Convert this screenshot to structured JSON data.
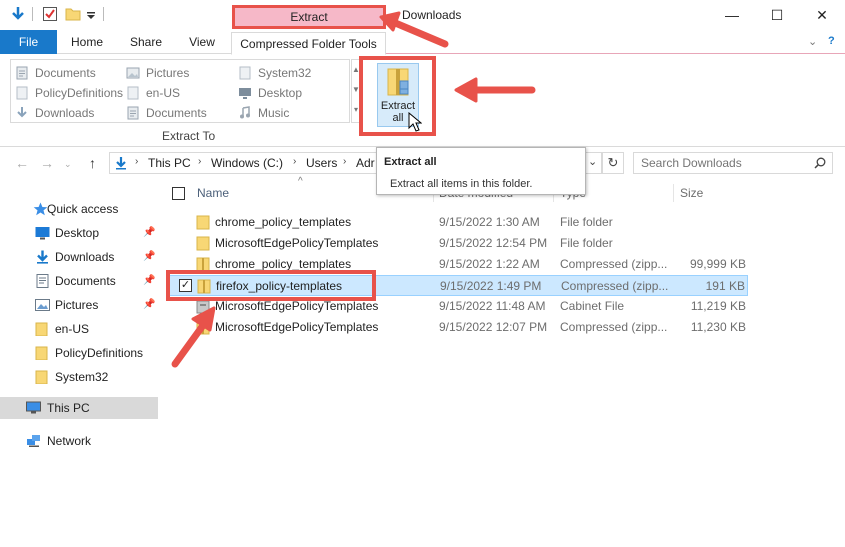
{
  "window": {
    "title": "Downloads",
    "context_tab_header": "Extract",
    "controls": {
      "minimize": "—",
      "maximize": "☐",
      "close": "✕"
    }
  },
  "ribbon": {
    "tabs": {
      "file": "File",
      "home": "Home",
      "share": "Share",
      "view": "View",
      "compressed": "Compressed Folder Tools"
    },
    "destinations": [
      {
        "label": "Documents",
        "icon": "documents-icon"
      },
      {
        "label": "Pictures",
        "icon": "pictures-icon"
      },
      {
        "label": "System32",
        "icon": "folder-icon"
      },
      {
        "label": "PolicyDefinitions",
        "icon": "folder-icon"
      },
      {
        "label": "en-US",
        "icon": "folder-icon"
      },
      {
        "label": "Desktop",
        "icon": "desktop-icon"
      },
      {
        "label": "Downloads",
        "icon": "downloads-icon"
      },
      {
        "label": "Documents",
        "icon": "documents-icon"
      },
      {
        "label": "Music",
        "icon": "music-icon"
      }
    ],
    "group_label": "Extract To",
    "extract_all": {
      "line1": "Extract",
      "line2": "all"
    }
  },
  "tooltip": {
    "title": "Extract all",
    "text": "Extract all items in this folder."
  },
  "address": {
    "segments": [
      "This PC",
      "Windows (C:)",
      "Users",
      "Adr"
    ],
    "search_placeholder": "Search Downloads"
  },
  "sidebar": {
    "items": [
      {
        "label": "Quick access",
        "icon": "star-icon",
        "pinned": false
      },
      {
        "label": "Desktop",
        "icon": "desktop-icon",
        "pinned": true
      },
      {
        "label": "Downloads",
        "icon": "downloads-icon",
        "pinned": true
      },
      {
        "label": "Documents",
        "icon": "documents-icon",
        "pinned": true
      },
      {
        "label": "Pictures",
        "icon": "pictures-icon",
        "pinned": true
      },
      {
        "label": "en-US",
        "icon": "folder-icon",
        "pinned": false
      },
      {
        "label": "PolicyDefinitions",
        "icon": "folder-icon",
        "pinned": false
      },
      {
        "label": "System32",
        "icon": "folder-icon",
        "pinned": false
      },
      {
        "label": "This PC",
        "icon": "computer-icon",
        "pinned": false
      },
      {
        "label": "Network",
        "icon": "network-icon",
        "pinned": false
      }
    ]
  },
  "file_list": {
    "columns": {
      "name": "Name",
      "date": "Date modified",
      "type": "Type",
      "size": "Size"
    },
    "rows": [
      {
        "name": "chrome_policy_templates",
        "date": "9/15/2022 1:30 AM",
        "type": "File folder",
        "size": "",
        "icon": "folder-icon"
      },
      {
        "name": "MicrosoftEdgePolicyTemplates",
        "date": "9/15/2022 12:54 PM",
        "type": "File folder",
        "size": "",
        "icon": "folder-icon"
      },
      {
        "name": "chrome_policy_templates",
        "date": "9/15/2022 1:22 AM",
        "type": "Compressed (zipp...",
        "size": "99,999 KB",
        "icon": "zip-folder-icon"
      },
      {
        "name": "firefox_policy-templates",
        "date": "9/15/2022 1:49 PM",
        "type": "Compressed (zipp...",
        "size": "191 KB",
        "icon": "zip-folder-icon",
        "selected": true
      },
      {
        "name": "MicrosoftEdgePolicyTemplates",
        "date": "9/15/2022 11:48 AM",
        "type": "Cabinet File",
        "size": "11,219 KB",
        "icon": "cabinet-file-icon"
      },
      {
        "name": "MicrosoftEdgePolicyTemplates",
        "date": "9/15/2022 12:07 PM",
        "type": "Compressed (zipp...",
        "size": "11,230 KB",
        "icon": "zip-folder-icon"
      }
    ]
  },
  "colors": {
    "accent": "#1979ca",
    "annotation": "#e8524a",
    "context_tab": "#f6b8c8",
    "selection": "#cce8ff"
  }
}
